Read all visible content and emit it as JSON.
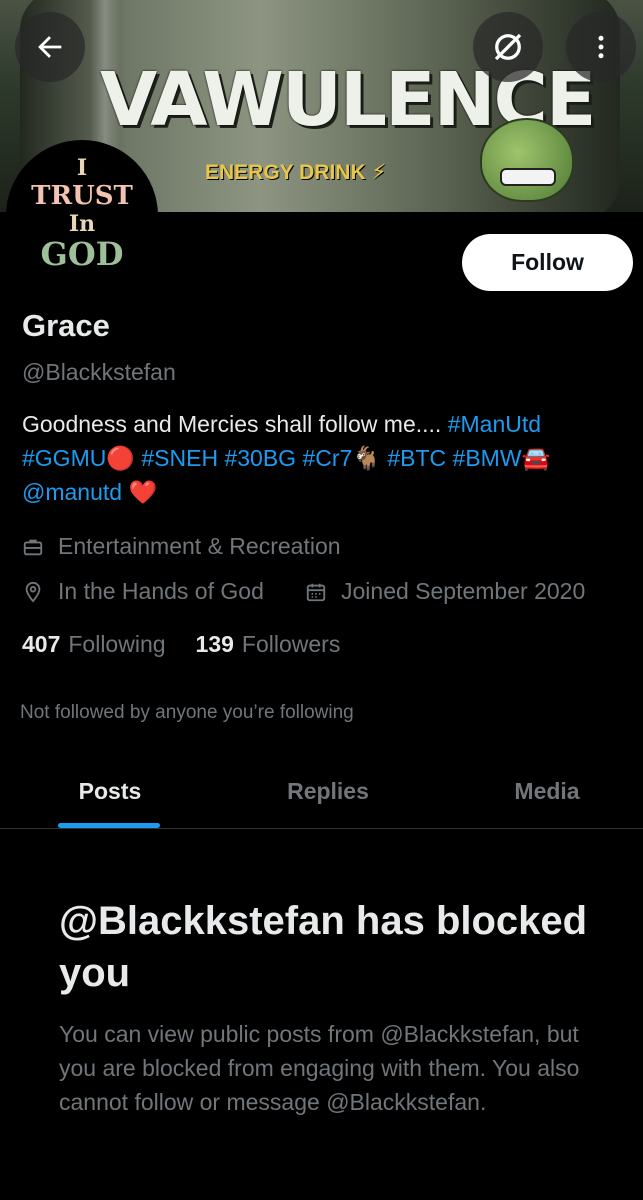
{
  "banner": {
    "brand_text": "VAWULENCE",
    "sub_text": "ENERGY DRINK ⚡"
  },
  "icons": {
    "back": "arrow-left-icon",
    "grok": "grok-icon",
    "more": "more-vertical-icon",
    "category": "briefcase-icon",
    "location": "location-pin-icon",
    "calendar": "calendar-icon"
  },
  "avatar": {
    "line1": "I",
    "line2": "TRUST",
    "line3": "In",
    "line4": "GOD"
  },
  "profile": {
    "follow_label": "Follow",
    "name": "Grace",
    "handle": "@Blackkstefan",
    "bio_text": "Goodness and Mercies shall follow me.... ",
    "bio_tag1": "#ManUtd",
    "bio_tag2": "#GGMU",
    "bio_emoji_red": "🔴",
    "bio_tag3": "#SNEH",
    "bio_tag4": "#30BG",
    "bio_tag5": "#Cr7",
    "bio_emoji_goat": "🐐",
    "bio_tag6": "#BTC",
    "bio_tag7": "#BMW",
    "bio_emoji_car": "🚘",
    "bio_mention": "@manutd",
    "bio_emoji_heart": "❤️",
    "category": "Entertainment & Recreation",
    "location": "In the Hands of God",
    "joined": "Joined September 2020",
    "following_count": "407",
    "following_label": "Following",
    "followers_count": "139",
    "followers_label": "Followers",
    "mutual_text": "Not followed by anyone you’re following"
  },
  "tabs": [
    {
      "label": "Posts",
      "active": true
    },
    {
      "label": "Replies",
      "active": false
    },
    {
      "label": "Media",
      "active": false
    }
  ],
  "blocked": {
    "title": "@Blackkstefan has blocked you",
    "description": "You can view public posts from @Blackkstefan, but you are blocked from engaging with them. You also cannot follow or message @Blackkstefan."
  },
  "colors": {
    "background": "#000000",
    "link": "#1d9bf0",
    "muted": "#71767b",
    "text": "#e7e9ea"
  }
}
